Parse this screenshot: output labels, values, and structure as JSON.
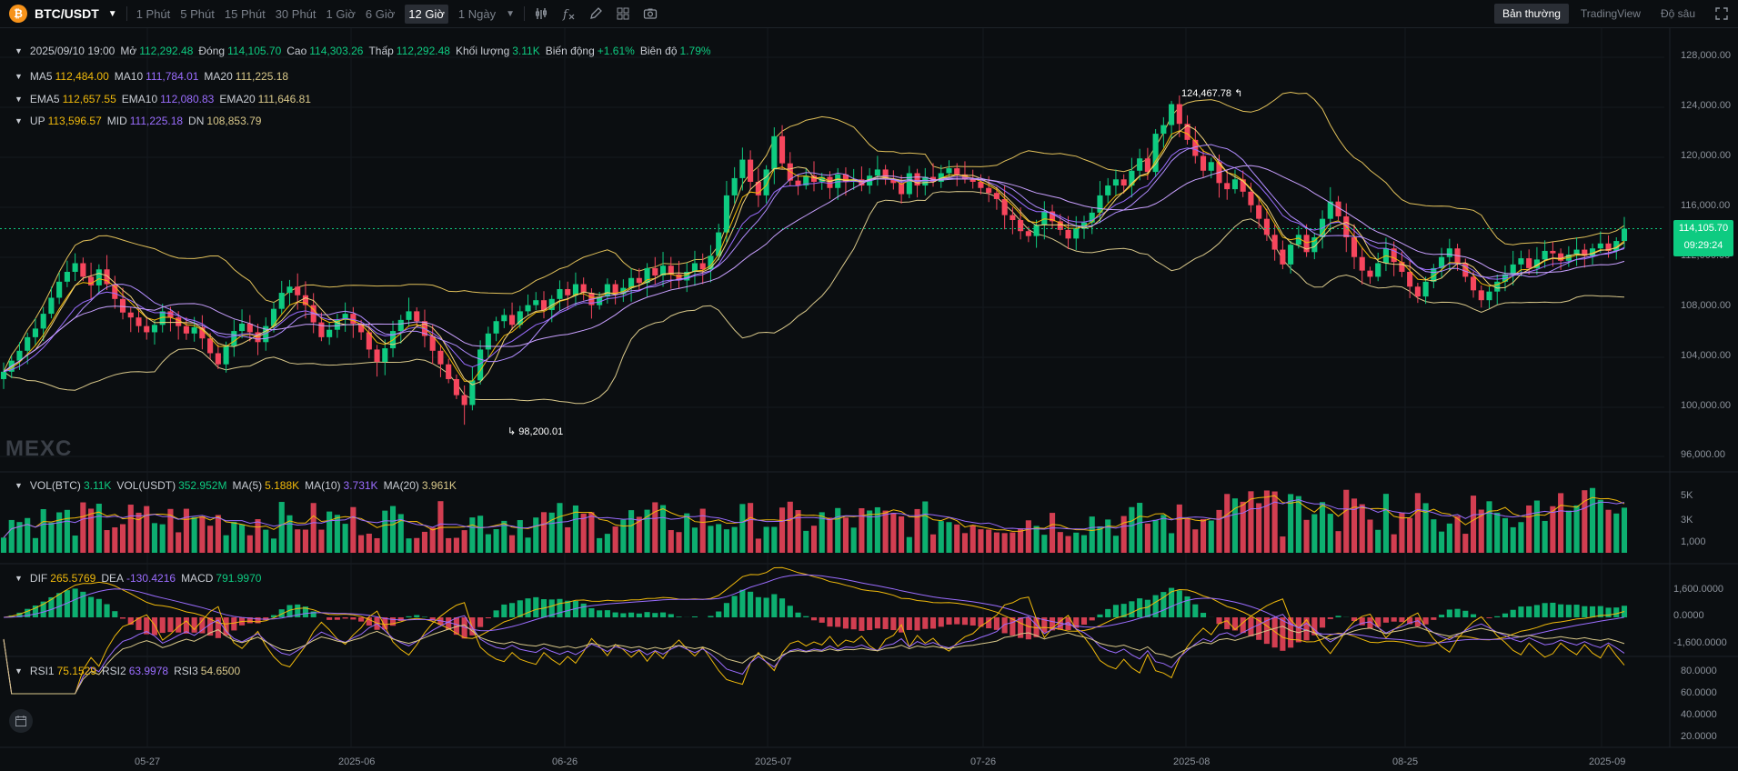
{
  "header": {
    "pair": "BTC/USDT",
    "timeframes": [
      "1 Phút",
      "5 Phút",
      "15 Phút",
      "30 Phút",
      "1 Giờ",
      "6 Giờ",
      "12 Giờ",
      "1 Ngày"
    ],
    "active_timeframe": "12 Giờ",
    "modes": [
      "Bản thường",
      "TradingView",
      "Độ sâu"
    ],
    "active_mode": "Bản thường"
  },
  "ohlc": {
    "date": "2025/09/10 19:00",
    "open_label": "Mở",
    "open": "112,292.48",
    "close_label": "Đóng",
    "close": "114,105.70",
    "high_label": "Cao",
    "high": "114,303.26",
    "low_label": "Thấp",
    "low": "112,292.48",
    "vol_label": "Khối lượng",
    "vol": "3.11K",
    "change_label": "Biến động",
    "change": "+1.61%",
    "amp_label": "Biên độ",
    "amp": "1.79%"
  },
  "ma": {
    "ma5_label": "MA5",
    "ma5": "112,484.00",
    "ma10_label": "MA10",
    "ma10": "111,784.01",
    "ma20_label": "MA20",
    "ma20": "111,225.18"
  },
  "ema": {
    "ema5_label": "EMA5",
    "ema5": "112,657.55",
    "ema10_label": "EMA10",
    "ema10": "112,080.83",
    "ema20_label": "EMA20",
    "ema20": "111,646.81"
  },
  "boll": {
    "up_label": "UP",
    "up": "113,596.57",
    "mid_label": "MID",
    "mid": "111,225.18",
    "dn_label": "DN",
    "dn": "108,853.79"
  },
  "vol": {
    "vbtc_label": "VOL(BTC)",
    "vbtc": "3.11K",
    "vusdt_label": "VOL(USDT)",
    "vusdt": "352.952M",
    "ma5_label": "MA(5)",
    "ma5": "5.188K",
    "ma10_label": "MA(10)",
    "ma10": "3.731K",
    "ma20_label": "MA(20)",
    "ma20": "3.961K"
  },
  "macd": {
    "dif_label": "DIF",
    "dif": "265.5769",
    "dea_label": "DEA",
    "dea": "-130.4216",
    "macd_label": "MACD",
    "macd": "791.9970"
  },
  "rsi": {
    "rsi1_label": "RSI1",
    "rsi1": "75.1529",
    "rsi2_label": "RSI2",
    "rsi2": "63.9978",
    "rsi3_label": "RSI3",
    "rsi3": "54.6500"
  },
  "price_axis": [
    "128,000.00",
    "124,000.00",
    "120,000.00",
    "116,000.00",
    "112,000.00",
    "108,000.00",
    "104,000.00",
    "100,000.00",
    "96,000.00"
  ],
  "vol_axis": [
    "5K",
    "3K",
    "1,000"
  ],
  "macd_axis": [
    "1,600.0000",
    "0.0000",
    "-1,600.0000"
  ],
  "rsi_axis": [
    "80.0000",
    "60.0000",
    "40.0000",
    "20.0000"
  ],
  "x_axis": [
    "05-27",
    "2025-06",
    "06-26",
    "2025-07",
    "07-26",
    "2025-08",
    "08-25",
    "2025-09"
  ],
  "last_price": "114,105.70",
  "countdown": "09:29:24",
  "high_mark": "124,467.78",
  "low_mark": "98,200.01",
  "watermark": "MEXC",
  "colors": {
    "up": "#0ecb81",
    "down": "#f6465d",
    "ma5": "#f0b90b",
    "ma10": "#9b6dff",
    "ma20": "#c9a0ff",
    "boll": "#e2c15a"
  },
  "chart_data": {
    "type": "candlestick",
    "ylim": [
      94000,
      130000
    ],
    "closes": [
      102500,
      103400,
      104200,
      105300,
      106000,
      107200,
      108500,
      109800,
      110600,
      111300,
      110200,
      109500,
      110800,
      109600,
      108400,
      107300,
      106900,
      106200,
      105700,
      106300,
      107400,
      106900,
      106200,
      105600,
      106100,
      105200,
      104000,
      103100,
      104600,
      105800,
      106400,
      105700,
      104900,
      106200,
      107600,
      108900,
      109400,
      108700,
      107900,
      106500,
      105300,
      105900,
      106700,
      107200,
      106400,
      105700,
      104300,
      103300,
      104400,
      105800,
      106700,
      107400,
      106600,
      105400,
      104200,
      103100,
      101900,
      100600,
      99800,
      101800,
      104300,
      105600,
      106600,
      107100,
      106300,
      107400,
      107900,
      108300,
      107500,
      108400,
      109200,
      108700,
      109600,
      108900,
      107900,
      108600,
      109600,
      108800,
      109300,
      110100,
      109700,
      110900,
      110300,
      111100,
      110400,
      109900,
      110600,
      111300,
      110800,
      111900,
      113800,
      116800,
      118200,
      119700,
      117900,
      116800,
      118900,
      121600,
      119400,
      118000,
      117600,
      118400,
      117900,
      118300,
      117400,
      118500,
      117900,
      118100,
      117600,
      118400,
      118900,
      118100,
      117800,
      116900,
      118600,
      117600,
      118300,
      117900,
      118600,
      119000,
      118500,
      118100,
      117900,
      117400,
      117000,
      116500,
      115200,
      114800,
      113900,
      113500,
      114400,
      115500,
      114700,
      114000,
      113300,
      114100,
      114600,
      115400,
      116800,
      117600,
      118100,
      117600,
      118800,
      119800,
      118700,
      121800,
      122500,
      124200,
      122600,
      121300,
      120000,
      118800,
      119500,
      117800,
      117300,
      118100,
      117100,
      116000,
      114900,
      113600,
      112400,
      111200,
      112800,
      113600,
      112200,
      113400,
      114900,
      116300,
      115100,
      113400,
      111800,
      110700,
      110200,
      111300,
      112500,
      111400,
      110600,
      109400,
      108600,
      109800,
      110900,
      111800,
      112500,
      111300,
      110200,
      109100,
      108300,
      109000,
      109800,
      110400,
      111200,
      111700,
      110900,
      111600,
      112300,
      112100,
      111500,
      112000,
      112400,
      111900,
      112500,
      112900,
      112300,
      113100,
      114100
    ]
  }
}
